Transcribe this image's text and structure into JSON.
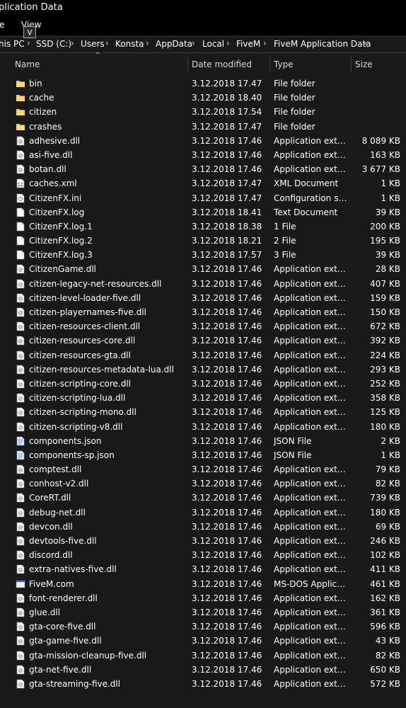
{
  "window": {
    "title": "plication Data"
  },
  "ribbon": {
    "tab_partial": "e",
    "view": "View",
    "view_keytip": "V"
  },
  "address": {
    "crumbs": [
      "his PC",
      "SSD (C:)",
      "Users",
      "Konsta",
      "AppData",
      "Local",
      "FiveM",
      "FiveM Application Data"
    ],
    "separator": "›",
    "dropdown": "⌄"
  },
  "columns": {
    "name": "Name",
    "date": "Date modified",
    "type": "Type",
    "size": "Size",
    "sort_indicator": "^"
  },
  "files": [
    {
      "name": "bin",
      "date": "3.12.2018 17.47",
      "type": "File folder",
      "size": "",
      "icon": "folder-icon"
    },
    {
      "name": "cache",
      "date": "3.12.2018 18.40",
      "type": "File folder",
      "size": "",
      "icon": "folder-icon"
    },
    {
      "name": "citizen",
      "date": "3.12.2018 17.54",
      "type": "File folder",
      "size": "",
      "icon": "folder-icon"
    },
    {
      "name": "crashes",
      "date": "3.12.2018 17.47",
      "type": "File folder",
      "size": "",
      "icon": "folder-icon"
    },
    {
      "name": "adhesive.dll",
      "date": "3.12.2018 17.46",
      "type": "Application extens...",
      "size": "8 089 KB",
      "icon": "dll-icon"
    },
    {
      "name": "asi-five.dll",
      "date": "3.12.2018 17.46",
      "type": "Application extens...",
      "size": "163 KB",
      "icon": "dll-icon"
    },
    {
      "name": "botan.dll",
      "date": "3.12.2018 17.46",
      "type": "Application extens...",
      "size": "3 677 KB",
      "icon": "dll-icon"
    },
    {
      "name": "caches.xml",
      "date": "3.12.2018 17.47",
      "type": "XML Document",
      "size": "1 KB",
      "icon": "xml-icon"
    },
    {
      "name": "CitizenFX.ini",
      "date": "3.12.2018 17.47",
      "type": "Configuration sett...",
      "size": "1 KB",
      "icon": "ini-icon"
    },
    {
      "name": "CitizenFX.log",
      "date": "3.12.2018 18.41",
      "type": "Text Document",
      "size": "39 KB",
      "icon": "file-icon"
    },
    {
      "name": "CitizenFX.log.1",
      "date": "3.12.2018 18.38",
      "type": "1 File",
      "size": "200 KB",
      "icon": "file-icon"
    },
    {
      "name": "CitizenFX.log.2",
      "date": "3.12.2018 18.21",
      "type": "2 File",
      "size": "195 KB",
      "icon": "file-icon"
    },
    {
      "name": "CitizenFX.log.3",
      "date": "3.12.2018 17.57",
      "type": "3 File",
      "size": "39 KB",
      "icon": "file-icon"
    },
    {
      "name": "CitizenGame.dll",
      "date": "3.12.2018 17.46",
      "type": "Application extens...",
      "size": "28 KB",
      "icon": "dll-icon"
    },
    {
      "name": "citizen-legacy-net-resources.dll",
      "date": "3.12.2018 17.46",
      "type": "Application extens...",
      "size": "407 KB",
      "icon": "dll-icon"
    },
    {
      "name": "citizen-level-loader-five.dll",
      "date": "3.12.2018 17.46",
      "type": "Application extens...",
      "size": "159 KB",
      "icon": "dll-icon"
    },
    {
      "name": "citizen-playernames-five.dll",
      "date": "3.12.2018 17.46",
      "type": "Application extens...",
      "size": "150 KB",
      "icon": "dll-icon"
    },
    {
      "name": "citizen-resources-client.dll",
      "date": "3.12.2018 17.46",
      "type": "Application extens...",
      "size": "672 KB",
      "icon": "dll-icon"
    },
    {
      "name": "citizen-resources-core.dll",
      "date": "3.12.2018 17.46",
      "type": "Application extens...",
      "size": "392 KB",
      "icon": "dll-icon"
    },
    {
      "name": "citizen-resources-gta.dll",
      "date": "3.12.2018 17.46",
      "type": "Application extens...",
      "size": "224 KB",
      "icon": "dll-icon"
    },
    {
      "name": "citizen-resources-metadata-lua.dll",
      "date": "3.12.2018 17.46",
      "type": "Application extens...",
      "size": "293 KB",
      "icon": "dll-icon"
    },
    {
      "name": "citizen-scripting-core.dll",
      "date": "3.12.2018 17.46",
      "type": "Application extens...",
      "size": "252 KB",
      "icon": "dll-icon"
    },
    {
      "name": "citizen-scripting-lua.dll",
      "date": "3.12.2018 17.46",
      "type": "Application extens...",
      "size": "358 KB",
      "icon": "dll-icon"
    },
    {
      "name": "citizen-scripting-mono.dll",
      "date": "3.12.2018 17.46",
      "type": "Application extens...",
      "size": "125 KB",
      "icon": "dll-icon"
    },
    {
      "name": "citizen-scripting-v8.dll",
      "date": "3.12.2018 17.46",
      "type": "Application extens...",
      "size": "180 KB",
      "icon": "dll-icon"
    },
    {
      "name": "components.json",
      "date": "3.12.2018 17.46",
      "type": "JSON File",
      "size": "2 KB",
      "icon": "json-icon"
    },
    {
      "name": "components-sp.json",
      "date": "3.12.2018 17.46",
      "type": "JSON File",
      "size": "1 KB",
      "icon": "json-icon"
    },
    {
      "name": "comptest.dll",
      "date": "3.12.2018 17.46",
      "type": "Application extens...",
      "size": "79 KB",
      "icon": "dll-icon"
    },
    {
      "name": "conhost-v2.dll",
      "date": "3.12.2018 17.46",
      "type": "Application extens...",
      "size": "82 KB",
      "icon": "dll-icon"
    },
    {
      "name": "CoreRT.dll",
      "date": "3.12.2018 17.46",
      "type": "Application extens...",
      "size": "739 KB",
      "icon": "dll-icon"
    },
    {
      "name": "debug-net.dll",
      "date": "3.12.2018 17.46",
      "type": "Application extens...",
      "size": "180 KB",
      "icon": "dll-icon"
    },
    {
      "name": "devcon.dll",
      "date": "3.12.2018 17.46",
      "type": "Application extens...",
      "size": "69 KB",
      "icon": "dll-icon"
    },
    {
      "name": "devtools-five.dll",
      "date": "3.12.2018 17.46",
      "type": "Application extens...",
      "size": "246 KB",
      "icon": "dll-icon"
    },
    {
      "name": "discord.dll",
      "date": "3.12.2018 17.46",
      "type": "Application extens...",
      "size": "102 KB",
      "icon": "dll-icon"
    },
    {
      "name": "extra-natives-five.dll",
      "date": "3.12.2018 17.46",
      "type": "Application extens...",
      "size": "411 KB",
      "icon": "dll-icon"
    },
    {
      "name": "FiveM.com",
      "date": "3.12.2018 17.46",
      "type": "MS-DOS Applicati...",
      "size": "461 KB",
      "icon": "app-icon"
    },
    {
      "name": "font-renderer.dll",
      "date": "3.12.2018 17.46",
      "type": "Application extens...",
      "size": "162 KB",
      "icon": "dll-icon"
    },
    {
      "name": "glue.dll",
      "date": "3.12.2018 17.46",
      "type": "Application extens...",
      "size": "361 KB",
      "icon": "dll-icon"
    },
    {
      "name": "gta-core-five.dll",
      "date": "3.12.2018 17.46",
      "type": "Application extens...",
      "size": "596 KB",
      "icon": "dll-icon"
    },
    {
      "name": "gta-game-five.dll",
      "date": "3.12.2018 17.46",
      "type": "Application extens...",
      "size": "43 KB",
      "icon": "dll-icon"
    },
    {
      "name": "gta-mission-cleanup-five.dll",
      "date": "3.12.2018 17.46",
      "type": "Application extens...",
      "size": "82 KB",
      "icon": "dll-icon"
    },
    {
      "name": "gta-net-five.dll",
      "date": "3.12.2018 17.46",
      "type": "Application extens...",
      "size": "650 KB",
      "icon": "dll-icon"
    },
    {
      "name": "gta-streaming-five.dll",
      "date": "3.12.2018 17.46",
      "type": "Application extens...",
      "size": "572 KB",
      "icon": "dll-icon"
    }
  ],
  "colors": {
    "background": "#191919",
    "folder": "#f2c55c",
    "text": "#ffffff"
  }
}
